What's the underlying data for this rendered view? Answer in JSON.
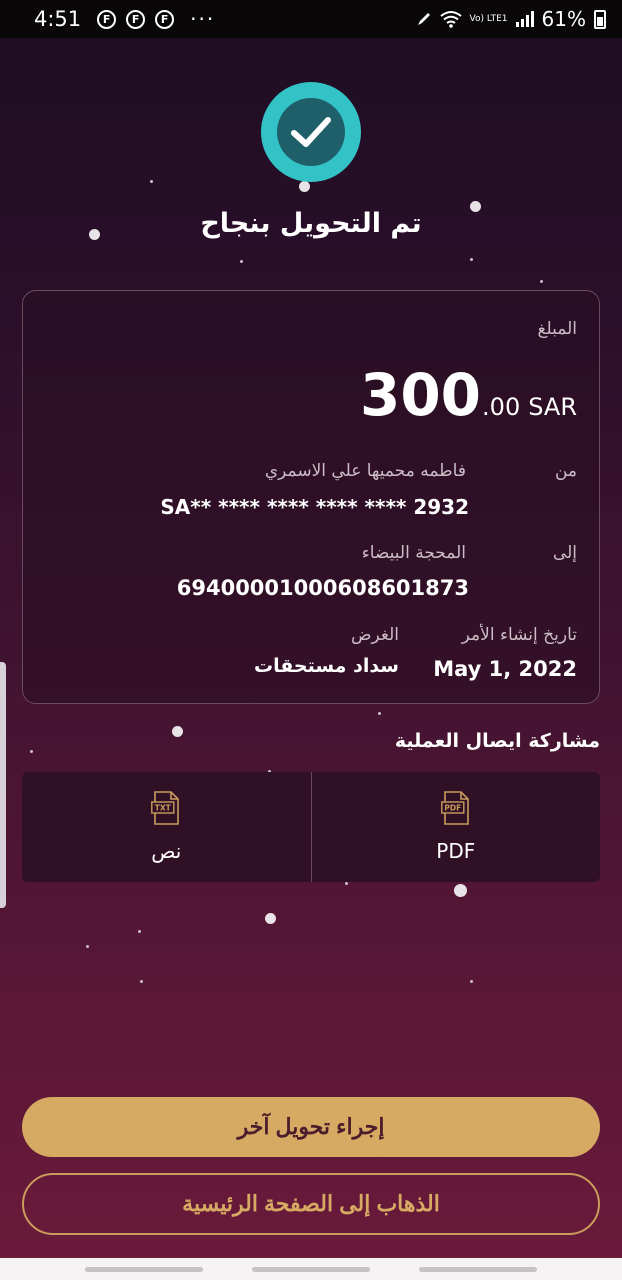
{
  "status_bar": {
    "time": "4:51",
    "notification_icons": [
      "F",
      "F",
      "F"
    ],
    "more": "···",
    "network_label": "Vo) LTE1",
    "battery": "61%"
  },
  "header": {
    "success_icon": "check-circle-icon",
    "title": "تم التحويل بنجاح"
  },
  "card": {
    "amount_label": "المبلغ",
    "amount_integer": "300",
    "amount_decimal": ".00",
    "currency": "SAR",
    "from_label": "من",
    "from_name": "فاطمه محميها علي الاسمري",
    "from_account": "SA** **** **** **** **** 2932",
    "to_label": "إلى",
    "to_name": "المحجة البيضاء",
    "to_account": "69400001000608601873",
    "date_label": "تاريخ إنشاء الأمر",
    "date_value": "May 1, 2022",
    "purpose_label": "الغرض",
    "purpose_value": "سداد مستحقات"
  },
  "share": {
    "title": "مشاركة ايصال العملية",
    "options": [
      {
        "label": "نص",
        "icon": "txt-file-icon",
        "icon_text": "TXT"
      },
      {
        "label": "PDF",
        "icon": "pdf-file-icon",
        "icon_text": "PDF"
      }
    ]
  },
  "buttons": {
    "new_transfer": "إجراء تحويل آخر",
    "go_home": "الذهاب إلى الصفحة الرئيسية"
  },
  "colors": {
    "accent_gold": "#d7aa63",
    "success_teal": "#33c3c6",
    "background_top": "#1d0d22",
    "background_bottom": "#6b1a3a"
  }
}
